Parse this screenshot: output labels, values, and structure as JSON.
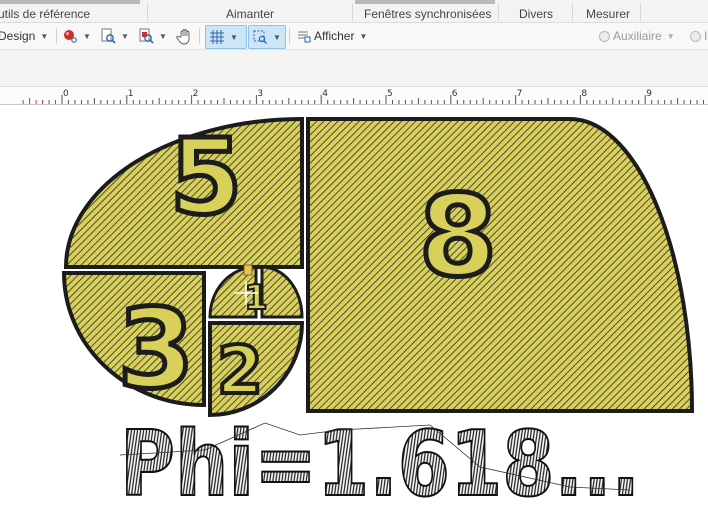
{
  "ribbon": {
    "groups": [
      {
        "label": "utils de référence"
      },
      {
        "label": "Aimanter"
      },
      {
        "label": "Fenêtres synchronisées"
      },
      {
        "label": "Divers"
      },
      {
        "label": "Mesurer"
      }
    ]
  },
  "toolbar": {
    "design_label": "Design",
    "show_label": "Afficher",
    "auxiliary_label": "Auxiliaire",
    "cut_label": "In"
  },
  "ruler": {
    "ticks": [
      "0",
      "1",
      "2",
      "3",
      "4",
      "5",
      "6",
      "7",
      "8",
      "9",
      "1"
    ]
  },
  "design": {
    "numbers": [
      "5",
      "8",
      "3",
      "2",
      "1"
    ],
    "formula": "Phi=1.618..."
  },
  "colors": {
    "fill": "#d8d05a",
    "outline": "#1c1c1c",
    "hatch": "#2c2c2c",
    "ribbon_bg": "#f3f3f3",
    "active_bg": "#cde6f7"
  },
  "icons": [
    "record-icon",
    "zoom-icon",
    "zoom-select-icon",
    "hand-icon",
    "grid-icon",
    "snap-icon",
    "show-icon"
  ]
}
